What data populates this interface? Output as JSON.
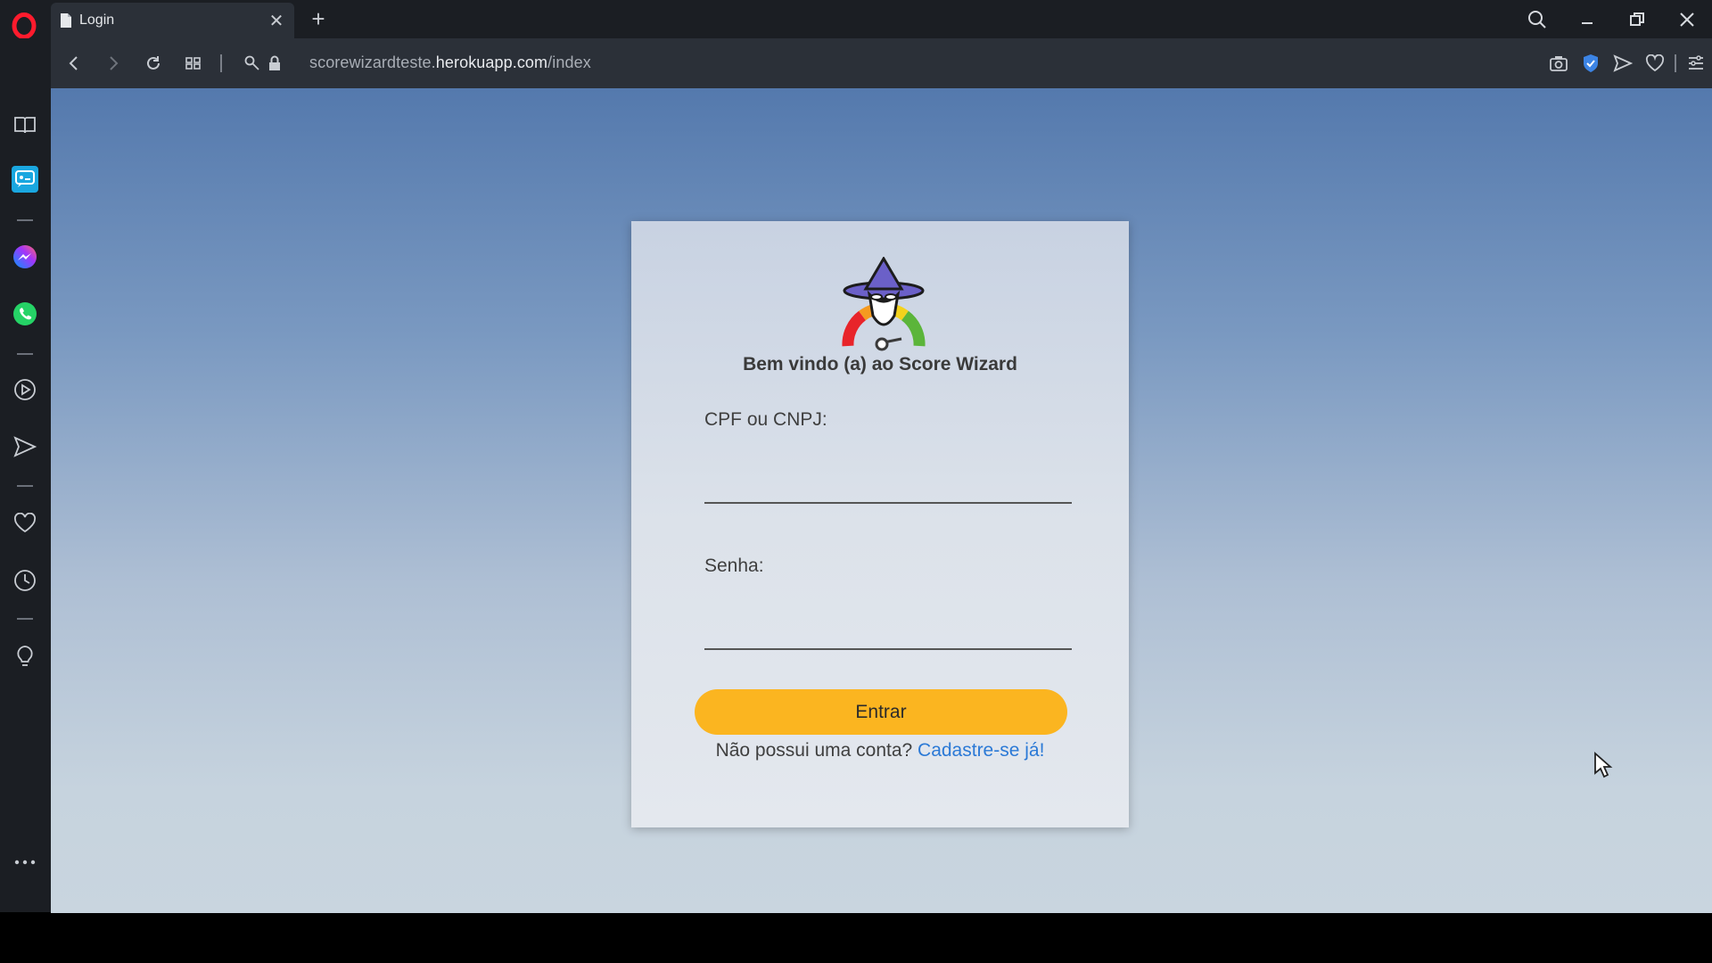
{
  "browser": {
    "tab_title": "Login",
    "tab_close": "✕",
    "new_tab": "+",
    "url_prefix": "scorewizardteste.",
    "url_host": "herokuapp.com",
    "url_path": "/index",
    "icons": {
      "logo": "opera-logo-icon",
      "search": "search-icon",
      "minimize": "minimize-icon",
      "restore": "restore-icon",
      "close": "close-icon",
      "back": "back-arrow-icon",
      "forward": "forward-arrow-icon",
      "reload": "reload-icon",
      "tabs_grid": "speed-dial-icon",
      "key": "key-icon",
      "lock": "lock-icon",
      "camera": "camera-icon",
      "shield": "vpn-shield-icon",
      "send": "send-icon",
      "heart": "heart-icon",
      "menu": "easy-setup-icon"
    },
    "accent_color": "#ff1b2d"
  },
  "sidebar": {
    "items": [
      {
        "name": "bookmarks-icon"
      },
      {
        "name": "messenger-icon"
      },
      {
        "name": "facebook-messenger-icon"
      },
      {
        "name": "whatsapp-icon"
      },
      {
        "name": "player-icon"
      },
      {
        "name": "send-icon"
      },
      {
        "name": "heart-icon"
      },
      {
        "name": "history-icon"
      },
      {
        "name": "lightbulb-icon"
      },
      {
        "name": "more-icon"
      }
    ]
  },
  "login": {
    "welcome": "Bem vindo (a) ao Score Wizard",
    "cpf_label": "CPF ou CNPJ:",
    "cpf_value": "",
    "password_label": "Senha:",
    "password_value": "",
    "submit_label": "Entrar",
    "no_account_text": "Não possui uma conta? ",
    "signup_link": "Cadastre-se já!",
    "button_color": "#fbb520",
    "link_color": "#2b79d6"
  }
}
